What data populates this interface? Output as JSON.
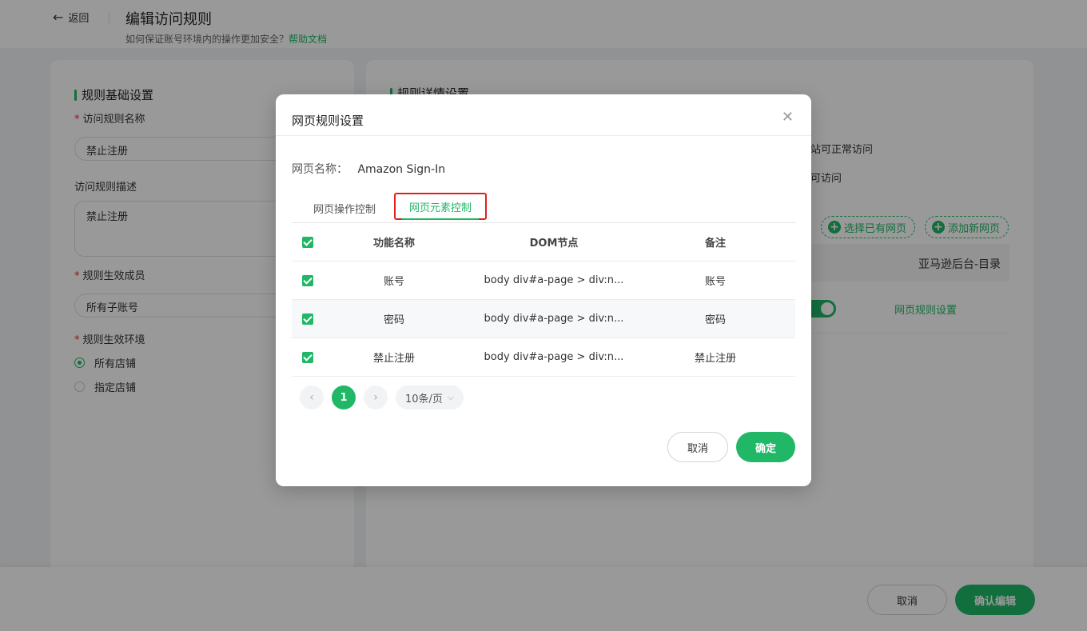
{
  "header": {
    "back_label": "返回",
    "title": "编辑访问规则",
    "subtitle": "如何保证账号环境内的操作更加安全？",
    "help_link": "帮助文档"
  },
  "left_card": {
    "section_title": "规则基础设置",
    "name_label": "访问规则名称",
    "name_value": "禁止注册",
    "desc_label": "访问规则描述",
    "desc_value": "禁止注册",
    "members_label": "规则生效成员",
    "members_value": "所有子账号",
    "env_label": "规则生效环境",
    "env_options": [
      "所有店铺",
      "指定店铺"
    ],
    "env_selected": "所有店铺"
  },
  "right_card": {
    "section_title": "规则详情设置",
    "text_1": "站可正常访问",
    "text_2": "可访问",
    "select_existing_btn": "选择已有网页",
    "add_new_btn": "添加新网页",
    "table_header_right": "亚马逊后台-目录",
    "row_link": "网页规则设置"
  },
  "footer": {
    "cancel_label": "取消",
    "confirm_label": "确认编辑"
  },
  "modal": {
    "title": "网页规则设置",
    "page_name_key": "网页名称：",
    "page_name_value": "Amazon Sign-In",
    "tabs": [
      {
        "label": "网页操作控制",
        "active": false
      },
      {
        "label": "网页元素控制",
        "active": true
      }
    ],
    "table": {
      "headers": [
        "功能名称",
        "DOM节点",
        "备注"
      ],
      "rows": [
        {
          "name": "账号",
          "dom": "body div#a-page > div:n...",
          "note": "账号",
          "checked": true
        },
        {
          "name": "密码",
          "dom": "body div#a-page > div:n...",
          "note": "密码",
          "checked": true
        },
        {
          "name": "禁止注册",
          "dom": "body div#a-page > div:n...",
          "note": "禁止注册",
          "checked": true
        }
      ]
    },
    "pagination": {
      "current_page": "1",
      "page_size": "10条/页"
    },
    "cancel_label": "取消",
    "ok_label": "确定"
  },
  "colors": {
    "accent": "#20b866",
    "highlight_border": "#e02020"
  }
}
